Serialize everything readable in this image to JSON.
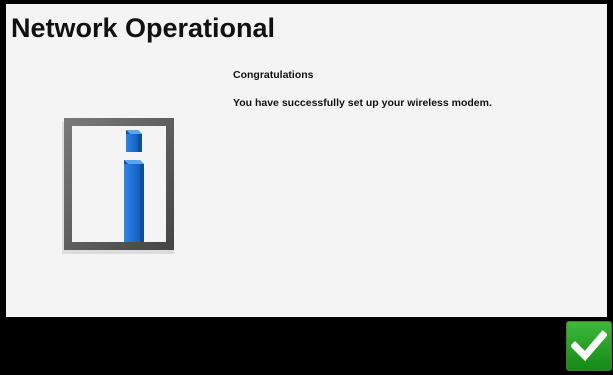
{
  "screen": {
    "title": "Network Operational"
  },
  "message": {
    "heading": "Congratulations",
    "body": "You have successfully set up your wireless modem."
  },
  "icons": {
    "info": "info-icon",
    "confirm": "checkmark-icon"
  },
  "colors": {
    "panel_background": "#f4f4f4",
    "bottom_bar": "#000000",
    "info_blue": "#1a6fd1",
    "info_frame": "#555555",
    "confirm_green": "#22a224"
  }
}
